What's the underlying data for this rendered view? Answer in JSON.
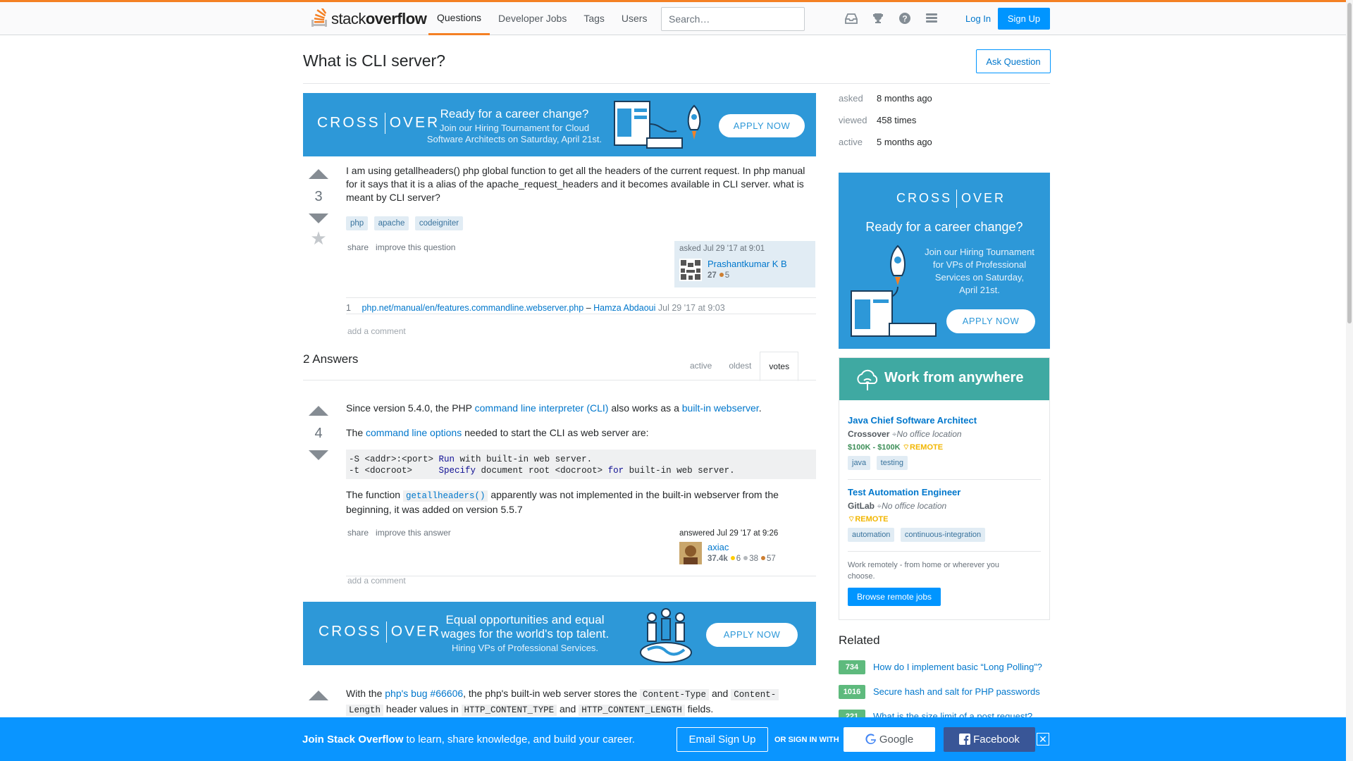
{
  "header": {
    "logo_prefix": "stack",
    "logo_suffix": "overflow",
    "nav": [
      "Questions",
      "Developer Jobs",
      "Tags",
      "Users"
    ],
    "search_placeholder": "Search…",
    "login": "Log In",
    "signup": "Sign Up",
    "accent": "#f48024"
  },
  "question": {
    "title": "What is CLI server?",
    "ask_button": "Ask Question",
    "votes": "3",
    "body": "I am using getallheaders() php global function to get all the headers of the current request. In php manual for it says that it is a alias of the apache_request_headers and it becomes available in CLI server. what is meant by CLI server?",
    "tags": [
      "php",
      "apache",
      "codeigniter"
    ],
    "share": "share",
    "improve": "improve this question",
    "asked": "asked Jul 29 '17 at 9:01",
    "author": "Prashantkumar K B",
    "rep": "27",
    "bronze": "5",
    "comment_score": "1",
    "comment_link": "php.net/manual/en/features.commandline.webserver.php",
    "comment_dash": "–",
    "comment_author": "Hamza Abdaoui",
    "comment_time": "Jul 29 '17 at 9:03",
    "add_comment": "add a comment"
  },
  "banner1": {
    "brand_left": "CROSS",
    "brand_right": "OVER",
    "headline": "Ready for a career change?",
    "sub1": "Join our Hiring Tournament for Cloud",
    "sub2": "Software Architects on Saturday, April 21st.",
    "apply": "APPLY NOW"
  },
  "answers": {
    "count_label": "2 Answers",
    "tabs": [
      "active",
      "oldest",
      "votes"
    ],
    "first": {
      "votes": "4",
      "p1_a": "Since version 5.4.0, the PHP ",
      "p1_link1": "command line interpreter (CLI)",
      "p1_b": " also works as a ",
      "p1_link2": "built-in webserver",
      "p1_c": ".",
      "p2_a": "The ",
      "p2_link": "command line options",
      "p2_b": " needed to start the CLI as web server are:",
      "code_l1_a": "-S <addr>:<port> ",
      "code_l1_b": "Run",
      "code_l1_c": " with built-in web server.",
      "code_l2_a": "-t <docroot>     ",
      "code_l2_b": "Specify",
      "code_l2_c": " document root <docroot> ",
      "code_l2_d": "for",
      "code_l2_e": " built-in web server.",
      "p3_a": "The function ",
      "p3_code": "getallheaders()",
      "p3_b": " apparently was not implemented in the built-in webserver from the beginning, it was added on version 5.5.7",
      "share": "share",
      "improve": "improve this answer",
      "answered": "answered Jul 29 '17 at 9:26",
      "author": "axiac",
      "rep": "37.4k",
      "gold": "6",
      "silver": "38",
      "bronze": "57",
      "add_comment": "add a comment"
    },
    "second": {
      "p1_a": "With the ",
      "p1_link1": "php's bug #66606",
      "p1_b": ", the php's built-in web server stores the ",
      "p1_code1": "Content-Type",
      "p1_c": " and ",
      "p1_code2": "Content-",
      "p2_code0": "Length",
      "p2_a": " header values in ",
      "p2_code1": "HTTP_CONTENT_TYPE",
      "p2_b": " and ",
      "p2_code2": "HTTP_CONTENT_LENGTH",
      "p2_c": " fields."
    }
  },
  "banner2": {
    "brand_left": "CROSS",
    "brand_right": "OVER",
    "line1": "Equal opportunities and equal",
    "line2": "wages for the world's top talent.",
    "line3": "Hiring VPs of Professional Services.",
    "apply": "APPLY NOW"
  },
  "sidebar": {
    "stats": [
      {
        "label": "asked",
        "value": "8 months ago"
      },
      {
        "label": "viewed",
        "value": "458 times"
      },
      {
        "label": "active",
        "value": "5 months ago"
      }
    ],
    "ad": {
      "brand_left": "CROSS",
      "brand_right": "OVER",
      "headline": "Ready for a career change?",
      "sub1": "Join our Hiring Tournament",
      "sub2": "for VPs of Professional",
      "sub3": "Services on Saturday,",
      "sub4": "April 21st.",
      "apply": "APPLY NOW"
    },
    "jobs": {
      "header": "Work from anywhere",
      "job1": {
        "title": "Java Chief Software Architect",
        "company": "Crossover",
        "location": "No office location",
        "salary": "$100K - $100K",
        "remote": "REMOTE",
        "tags": [
          "java",
          "testing"
        ]
      },
      "job2": {
        "title": "Test Automation Engineer",
        "company": "GitLab",
        "location": "No office location",
        "remote": "REMOTE",
        "tags": [
          "automation",
          "continuous-integration"
        ]
      },
      "blurb": "Work remotely - from home or wherever you choose.",
      "browse": "Browse remote jobs"
    },
    "related_title": "Related",
    "related": [
      {
        "score": "734",
        "title": "How do I implement basic “Long Polling”?"
      },
      {
        "score": "1016",
        "title": "Secure hash and salt for PHP passwords"
      },
      {
        "score": "221",
        "title": "What is the size limit of a post request?"
      }
    ]
  },
  "footer": {
    "brand": "Join Stack Overflow",
    "rest": " to learn, share knowledge, and build your career.",
    "email": "Email Sign Up",
    "or": "OR SIGN IN WITH",
    "google": "Google",
    "facebook": "Facebook",
    "close": "✕"
  }
}
